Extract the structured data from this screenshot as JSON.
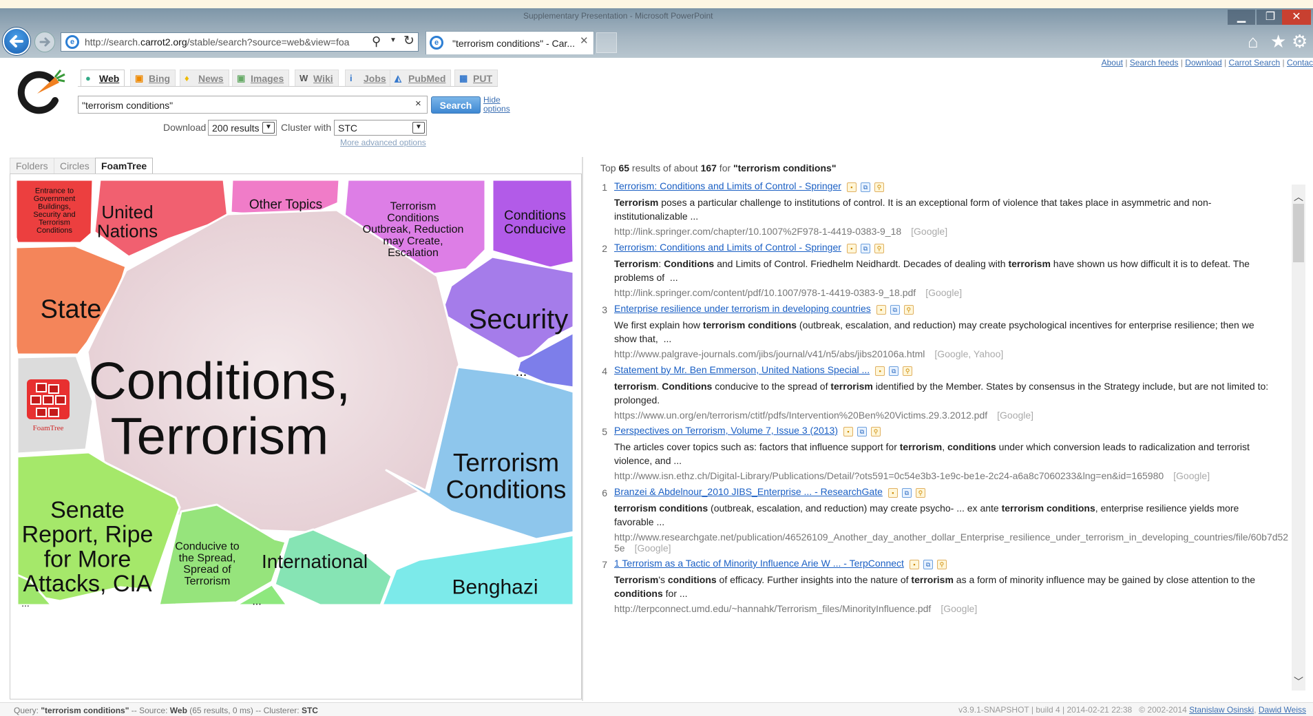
{
  "window": {
    "title": "Supplementary Presentation - Microsoft PowerPoint",
    "minimize": "▁",
    "maximize": "❐",
    "close": "✕"
  },
  "browser": {
    "url": "http://search.carrot2.org/stable/search?source=web&view=foa",
    "url_prefix": "http://search.",
    "url_host": "carrot2.org",
    "url_rest": "/stable/search?source=web&view=foa",
    "tab_title": "\"terrorism conditions\" - Car...",
    "tab_close": "✕",
    "home_icon": "⌂",
    "star_icon": "★",
    "gear_icon": "⚙"
  },
  "toplinks": [
    {
      "label": "About"
    },
    {
      "label": "Search feeds"
    },
    {
      "label": "Download"
    },
    {
      "label": "Carrot Search"
    },
    {
      "label": "Contac"
    }
  ],
  "sources": [
    {
      "label": "Web",
      "icon": "●"
    },
    {
      "label": "Bing",
      "icon": "▣"
    },
    {
      "label": "News",
      "icon": "♦"
    },
    {
      "label": "Images",
      "icon": "▣"
    },
    {
      "label": "Wiki",
      "icon": "W"
    },
    {
      "label": "Jobs",
      "icon": "i"
    },
    {
      "label": "PubMed",
      "icon": "◭"
    },
    {
      "label": "PUT",
      "icon": "▦"
    }
  ],
  "search": {
    "query": "\"terrorism conditions\"",
    "clear": "×",
    "button": "Search",
    "hide_options_1": "Hide",
    "hide_options_2": "options",
    "download_label": "Download",
    "download_value": "200 results",
    "cluster_label": "Cluster with",
    "cluster_value": "STC",
    "advanced": "More advanced options"
  },
  "view_tabs": [
    {
      "label": "Folders"
    },
    {
      "label": "Circles"
    },
    {
      "label": "FoamTree"
    }
  ],
  "foamtree": {
    "cells": [
      {
        "label": "Entrance to|Government|Buildings,|Security and|Terrorism|Conditions",
        "color": "#ec3f3f"
      },
      {
        "label": "United|Nations",
        "color": "#f16070"
      },
      {
        "label": "Other Topics",
        "color": "#f07cc8"
      },
      {
        "label": "Terrorism|Conditions|Outbreak, Reduction|may Create,|Escalation",
        "color": "#dd7ee6"
      },
      {
        "label": "Conditions|Conducive",
        "color": "#b25be8"
      },
      {
        "label": "State",
        "color": "#f4855a"
      },
      {
        "label": "Security",
        "color": "#a57cea"
      },
      {
        "label": "...",
        "color": "#7d7eea"
      },
      {
        "label": "Conditions,|Terrorism",
        "color": "#ecdcdf"
      },
      {
        "label": "FoamTree",
        "color": "#dcdcdc"
      },
      {
        "label": "Terrorism|Conditions",
        "color": "#8ec6ec"
      },
      {
        "label": "Senate|Report, Ripe|for More|Attacks, CIA",
        "color": "#a5e86a"
      },
      {
        "label": "Conducive to|the Spread,|Spread of|Terrorism",
        "color": "#96e47c"
      },
      {
        "label": "International",
        "color": "#86e4b4"
      },
      {
        "label": "Benghazi",
        "color": "#7ceaea"
      },
      {
        "label": "...",
        "color": "#8ee87e"
      },
      {
        "label": "...",
        "color": "#9ee66c"
      }
    ]
  },
  "results_header": {
    "pre": "Top ",
    "count": "65",
    "mid": " results of about ",
    "total": "167",
    "for": " for ",
    "query": "\"terrorism conditions\""
  },
  "results": [
    {
      "num": "1",
      "title": "Terrorism: Conditions and Limits of Control - Springer",
      "snippet_html": "<b>Terrorism</b> poses a particular challenge to institutions of control. It is an exceptional form of violence that takes place in asymmetric and non-institutionalizable ...",
      "url": "http://link.springer.com/chapter/10.1007%2F978-1-4419-0383-9_18",
      "sources": "[Google]"
    },
    {
      "num": "2",
      "title": "Terrorism: Conditions and Limits of Control - Springer",
      "snippet_html": "<b>Terrorism</b>: <b>Conditions</b> and Limits of Control. Friedhelm Neidhardt. Decades of dealing with <b>terrorism</b> have shown us how difficult it is to defeat. The problems of &nbsp;...",
      "url": "http://link.springer.com/content/pdf/10.1007/978-1-4419-0383-9_18.pdf",
      "sources": "[Google]"
    },
    {
      "num": "3",
      "title": "Enterprise resilience under terrorism in developing countries",
      "snippet_html": "We first explain how <b>terrorism conditions</b> (outbreak, escalation, and reduction) may create psychological incentives for enterprise resilience; then we show that, &nbsp;...",
      "url": "http://www.palgrave-journals.com/jibs/journal/v41/n5/abs/jibs20106a.html",
      "sources": "[Google, Yahoo]"
    },
    {
      "num": "4",
      "title": "Statement by Mr. Ben Emmerson, United Nations Special ...",
      "snippet_html": "<b>terrorism</b>. <b>Conditions</b> conducive to the spread of <b>terrorism</b> identified by the Member. States by consensus in the Strategy include, but are not limited to: prolonged.",
      "url": "https://www.un.org/en/terrorism/ctitf/pdfs/Intervention%20Ben%20Victims.29.3.2012.pdf",
      "sources": "[Google]"
    },
    {
      "num": "5",
      "title": "Perspectives on Terrorism, Volume 7, Issue 3 (2013)",
      "snippet_html": "The articles cover topics such as: factors that influence support for <b>terrorism</b>, <b>conditions</b> under which conversion leads to radicalization and terrorist violence, and ...",
      "url": "http://www.isn.ethz.ch/Digital-Library/Publications/Detail/?ots591=0c54e3b3-1e9c-be1e-2c24-a6a8c7060233&lng=en&id=165980",
      "sources": "[Google]"
    },
    {
      "num": "6",
      "title": "Branzei & Abdelnour_2010 JIBS_Enterprise ... - ResearchGate",
      "snippet_html": "<b>terrorism conditions</b> (outbreak, escalation, and reduction) may create psycho- ... ex ante <b>terrorism conditions</b>, enterprise resilience yields more favorable ...",
      "url": "http://www.researchgate.net/publication/46526109_Another_day_another_dollar_Enterprise_resilience_under_terrorism_in_developing_countries/file/60b7d525e",
      "sources": "[Google]"
    },
    {
      "num": "7",
      "title": "1 Terrorism as a Tactic of Minority Influence Arie W ... - TerpConnect",
      "snippet_html": "<b>Terrorism</b>'s <b>conditions</b> of efficacy. Further insights into the nature of <b>terrorism</b> as a form of minority influence may be gained by close attention to the <b>conditions</b> for ...",
      "url": "http://terpconnect.umd.edu/~hannahk/Terrorism_files/MinorityInfluence.pdf",
      "sources": "[Google]"
    }
  ],
  "footer": {
    "query_label": "Query: ",
    "query": "\"terrorism conditions\"",
    "source_label": " -- Source: ",
    "source": "Web",
    "source_meta": " (65 results, 0 ms) -- Clusterer: ",
    "clusterer": "STC",
    "version": "v3.9.1-SNAPSHOT | build 4 | 2014-02-21 22:38",
    "copyright": "© 2002-2014",
    "author1": "Stanislaw Osinski",
    "author2": "Dawid Weiss"
  },
  "colors": {
    "accent": "#3e88d3",
    "link": "#1a5fc4"
  }
}
